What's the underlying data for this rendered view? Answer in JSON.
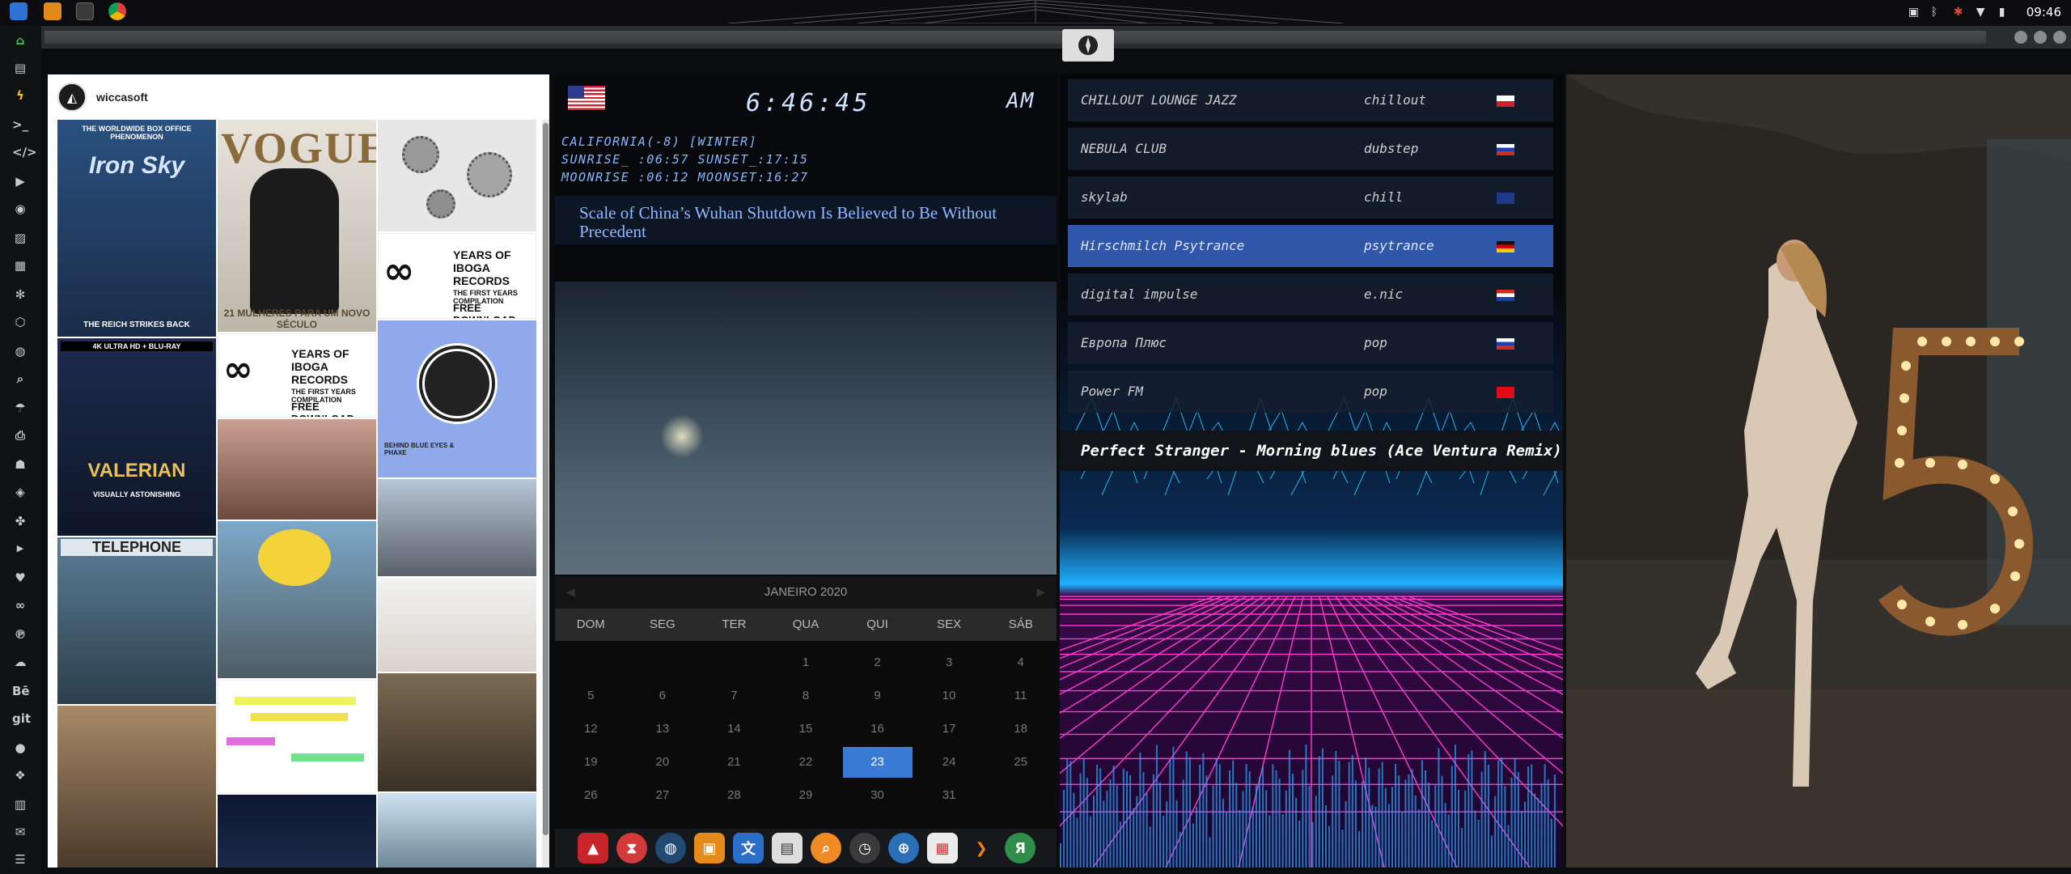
{
  "topbar": {
    "clock": "09:46",
    "apps": [
      "files-icon",
      "sublime-icon",
      "terminal-icon",
      "chrome-icon"
    ],
    "tray": [
      "image-icon",
      "bluetooth-icon",
      "bug-icon",
      "wifi-icon",
      "battery-icon"
    ]
  },
  "leftdock": {
    "icons": [
      "home-icon",
      "document-icon",
      "bolt-icon",
      "terminal-icon",
      "code-icon",
      "play-icon",
      "camera-icon",
      "image-icon",
      "news-icon",
      "asterisk-icon",
      "hexagon-icon",
      "globe-icon",
      "search-icon",
      "umbrella-icon",
      "printer-icon",
      "contact-icon",
      "tag-icon",
      "puzzle-icon",
      "youtube-icon",
      "heart-icon",
      "infinity-icon",
      "pinterest-icon",
      "cloud-icon",
      "behance-icon",
      "git-icon",
      "github-icon",
      "dropbox-icon",
      "map-icon",
      "mail-icon",
      "list-icon"
    ],
    "behance": "Bē",
    "git": "git"
  },
  "instagram": {
    "username": "wiccasoft",
    "tiles": {
      "t1_top": "THE WORLDWIDE BOX OFFICE PHENOMENON",
      "t1_title": "Iron Sky",
      "t1_bottom": "THE REICH STRIKES BACK",
      "t2_title": "VOGUE",
      "t2_sub": "21 MULHERES PARA UM NOVO SÉCULO",
      "t4_title": "YEARS OF IBOGA RECORDS",
      "t4_sub": "THE FIRST YEARS COMPILATION",
      "t4_cta": "FREE DOWNLOAD",
      "t5_top": "4K ULTRA HD + BLU-RAY",
      "t5_title": "VALERIAN",
      "t5_bottom": "VISUALLY ASTONISHING",
      "t8_label": "BEHIND BLUE EYES & PHAXE",
      "t10_title": "TELEPHONE"
    }
  },
  "clockwidget": {
    "time": "6:46:45",
    "ampm": "AM",
    "location": "CALIFORNIA(-8) [WINTER]",
    "sun": "SUNRISE_ :06:57 SUNSET_:17:15",
    "moon": "MOONRISE :06:12 MOONSET:16:27",
    "headline": "Scale of China’s Wuhan Shutdown Is Believed to Be Without Precedent"
  },
  "calendar": {
    "month": "JANEIRO 2020",
    "weekdays": [
      "DOM",
      "SEG",
      "TER",
      "QUA",
      "QUI",
      "SEX",
      "SÁB"
    ],
    "rows": [
      [
        "",
        "",
        "",
        "1",
        "2",
        "3",
        "4"
      ],
      [
        "5",
        "6",
        "7",
        "8",
        "9",
        "10",
        "11"
      ],
      [
        "12",
        "13",
        "14",
        "15",
        "16",
        "17",
        "18"
      ],
      [
        "19",
        "20",
        "21",
        "22",
        "23",
        "24",
        "25"
      ],
      [
        "26",
        "27",
        "28",
        "29",
        "30",
        "31",
        ""
      ]
    ],
    "today": "23"
  },
  "taskbar": [
    "launcher-icon",
    "hourglass-icon",
    "earth-icon",
    "photos-icon",
    "translate-icon",
    "news-icon",
    "search-icon",
    "clock-icon",
    "globe-icon",
    "calendar-icon",
    "arrow-icon",
    "yandex-icon"
  ],
  "radio": {
    "stations": [
      {
        "name": "CHILLOUT LOUNGE JAZZ",
        "genre": "chillout",
        "flag": "pl"
      },
      {
        "name": "NEBULA CLUB",
        "genre": "dubstep",
        "flag": "ru"
      },
      {
        "name": "skylab",
        "genre": "chill",
        "flag": "uk"
      },
      {
        "name": "Hirschmilch Psytrance",
        "genre": "psytrance",
        "flag": "de"
      },
      {
        "name": "digital impulse",
        "genre": "e.nic",
        "flag": "hr"
      },
      {
        "name": "Европа Плюс",
        "genre": "pop",
        "flag": "ru"
      },
      {
        "name": "Power FM",
        "genre": "pop",
        "flag": "tr"
      }
    ],
    "active_index": 3,
    "now_playing": "Perfect Stranger - Morning blues (Ace Ventura Remix)"
  },
  "colors": {
    "accent": "#3a7bd5",
    "radio_active": "#2f56a8",
    "neon_blue": "#27b8ff",
    "neon_pink": "#ff3ad0"
  }
}
